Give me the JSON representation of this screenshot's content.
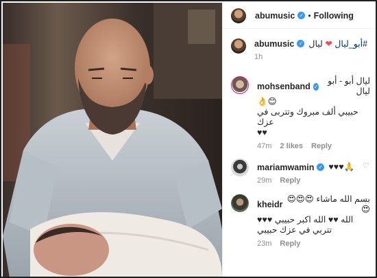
{
  "post": {
    "author": "abumusic",
    "follow_status": "Following",
    "separator": "•"
  },
  "caption": {
    "author": "abumusic",
    "text_plain": "ليال",
    "heart": "❤",
    "hashtag": "#أبو_ليال",
    "time": "1h"
  },
  "comments": [
    {
      "author": "mohsenband",
      "verified": true,
      "lines": [
        "ليال أبو - أبو ليال",
        "👌😊",
        "حبيبي ألف مبروك وتتربى في عزك",
        "♥♥"
      ],
      "time": "47m",
      "likes": "2 likes",
      "reply": "Reply"
    },
    {
      "author": "mariamwamin",
      "verified": true,
      "text": "♥♥♥🙏",
      "time": "29m",
      "reply": "Reply"
    },
    {
      "author": "kheidr",
      "verified": false,
      "lines": [
        "بسم الله ماشاء 😍😍😍😍",
        "الله ♥♥ الله اكبر حبيبي ♥♥♥",
        "تتربي في عزك حبيبي"
      ],
      "time": "23m",
      "reply": "Reply"
    }
  ],
  "icons": {
    "verified": "verified-badge-icon",
    "like": "heart-outline-icon"
  },
  "colors": {
    "accent_blue": "#3897f0",
    "heart_red": "#ed4956",
    "muted": "#8e8e8e",
    "hashtag": "#003569"
  }
}
